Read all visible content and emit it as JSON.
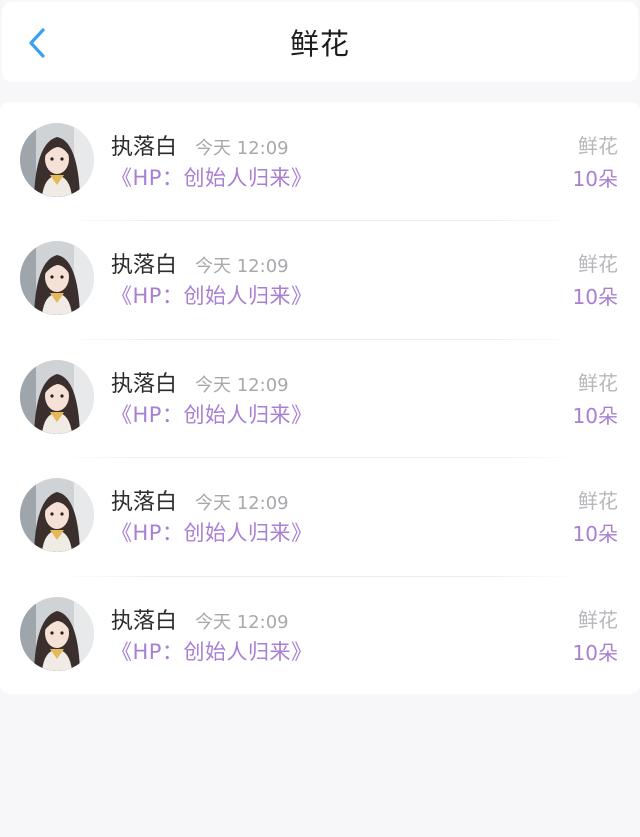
{
  "header": {
    "title": "鲜花",
    "back_icon": "chevron-left-icon",
    "accent_color": "#3aa0ee"
  },
  "records": [
    {
      "user": "执落白",
      "time": "今天 12:09",
      "book": "《HP：创始人归来》",
      "gift": "鲜花",
      "count": "10朵"
    },
    {
      "user": "执落白",
      "time": "今天 12:09",
      "book": "《HP：创始人归来》",
      "gift": "鲜花",
      "count": "10朵"
    },
    {
      "user": "执落白",
      "time": "今天 12:09",
      "book": "《HP：创始人归来》",
      "gift": "鲜花",
      "count": "10朵"
    },
    {
      "user": "执落白",
      "time": "今天 12:09",
      "book": "《HP：创始人归来》",
      "gift": "鲜花",
      "count": "10朵"
    },
    {
      "user": "执落白",
      "time": "今天 12:09",
      "book": "《HP：创始人归来》",
      "gift": "鲜花",
      "count": "10朵"
    }
  ],
  "colors": {
    "link_purple": "#a87fd3",
    "muted_gray": "#b7b7bc",
    "background": "#f7f6f8"
  }
}
